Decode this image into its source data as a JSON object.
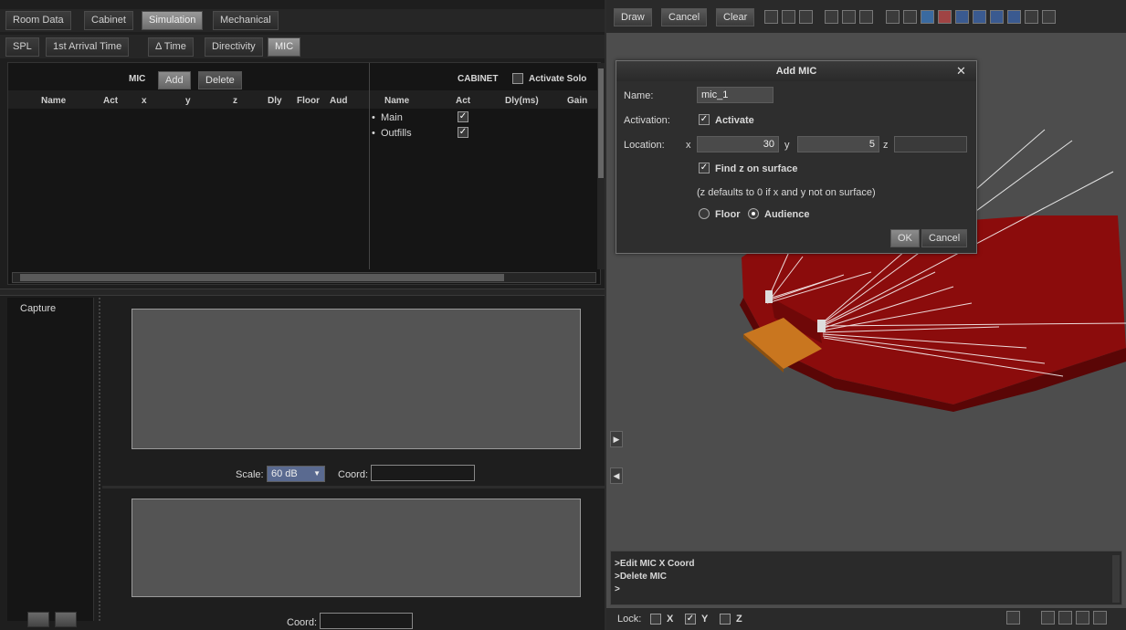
{
  "top_tabs": [
    "Room Data",
    "Cabinet",
    "Simulation",
    "Mechanical"
  ],
  "top_tab_active": "Simulation",
  "sub_tabs": [
    "SPL",
    "1st Arrival Time",
    "Δ Time",
    "Directivity",
    "MIC"
  ],
  "sub_tab_active": "MIC",
  "mic_section": {
    "label": "MIC",
    "add_label": "Add",
    "delete_label": "Delete",
    "columns": [
      "Name",
      "Act",
      "x",
      "y",
      "z",
      "Dly",
      "Floor",
      "Aud"
    ]
  },
  "cabinet_section": {
    "label": "CABINET",
    "activate_label": "Activate Solo",
    "columns": [
      "Name",
      "Act",
      "Dly(ms)",
      "Gain"
    ],
    "rows": [
      {
        "bullet": "•",
        "name": "Main",
        "act": true
      },
      {
        "bullet": "•",
        "name": "Outfills",
        "act": true
      }
    ]
  },
  "capture": {
    "label": "Capture",
    "scale_label": "Scale:",
    "scale_value": "60 dB",
    "coord_label": "Coord:",
    "coord_label_bottom": "Coord:"
  },
  "right_toolbar": {
    "draw_label": "Draw",
    "cancel_label": "Cancel",
    "clear_label": "Clear"
  },
  "dialog": {
    "title": "Add MIC",
    "close_icon": "✕",
    "name_label": "Name:",
    "name_value": "mic_1",
    "activation_label": "Activation:",
    "activate_label": "Activate",
    "activate_checked": true,
    "location_label": "Location:",
    "x_label": "x",
    "x_value": "30",
    "y_label": "y",
    "y_value": "5",
    "z_label": "z",
    "z_value": "",
    "find_z_label": "Find z on surface",
    "find_z_checked": true,
    "hint": "(z defaults to 0 if x and y not on surface)",
    "floor_label": "Floor",
    "audience_label": "Audience",
    "selected_surface": "Audience",
    "ok_label": "OK",
    "cancel_label": "Cancel"
  },
  "console": {
    "lines": [
      ">Edit MIC X Coord",
      ">Delete MIC",
      ">"
    ]
  },
  "status_bar": {
    "lock_label": "Lock:",
    "x_label": "X",
    "y_label": "Y",
    "z_label": "Z",
    "x_checked": false,
    "y_checked": true,
    "z_checked": false
  },
  "colors": {
    "venue": "#8b0c0c",
    "venue_dark": "#5a0606",
    "stage": "#c9761f",
    "rays": "#ffffff"
  }
}
